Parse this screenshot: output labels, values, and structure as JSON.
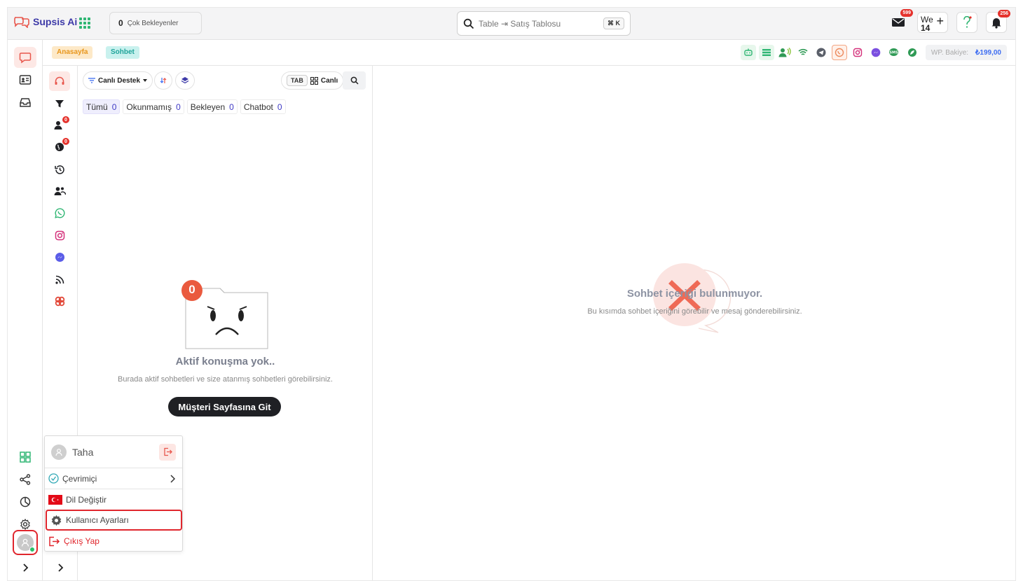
{
  "app": {
    "name": "Supsis Ai"
  },
  "topbar": {
    "waiting_count": "0",
    "waiting_label": "Çok Bekleyenler",
    "search_placeholder": "Table ⇥ Satış Tablosu",
    "search_shortcut": "⌘ K",
    "mail_badge": "599",
    "weekday": "We",
    "day": "14",
    "notif_badge": "256"
  },
  "breadcrumbs": [
    {
      "label": "Anasayfa"
    },
    {
      "label": "Sohbet"
    }
  ],
  "balance": {
    "label": "WP. Bakiye:",
    "value": "₺199,00"
  },
  "filters": {
    "scope_label": "Canlı Destek",
    "tab_key": "TAB",
    "view_label": "Canlı"
  },
  "tabs": [
    {
      "label": "Tümü",
      "count": "0"
    },
    {
      "label": "Okunmamış",
      "count": "0"
    },
    {
      "label": "Bekleyen",
      "count": "0"
    },
    {
      "label": "Chatbot",
      "count": "0"
    }
  ],
  "subrail_badges": {
    "queue": "0",
    "global": "0"
  },
  "empty_left": {
    "count": "0",
    "title": "Aktif konuşma yok..",
    "subtitle": "Burada aktif sohbetleri ve size atanmış sohbetleri görebilirsiniz.",
    "button": "Müşteri Sayfasına Git"
  },
  "empty_right": {
    "title": "Sohbet içeriği bulunmuyor.",
    "subtitle": "Bu kısımda sohbet içeriğini görebilir ve mesaj gönderebilirsiniz."
  },
  "user_menu": {
    "name": "Taha",
    "status": "Çevrimiçi",
    "language": "Dil Değiştir",
    "settings": "Kullanıcı Ayarları",
    "logout": "Çıkış Yap"
  },
  "colors": {
    "accent": "#e0262d",
    "brand": "#3d3aa8",
    "primary_value": "#3d6df2"
  }
}
